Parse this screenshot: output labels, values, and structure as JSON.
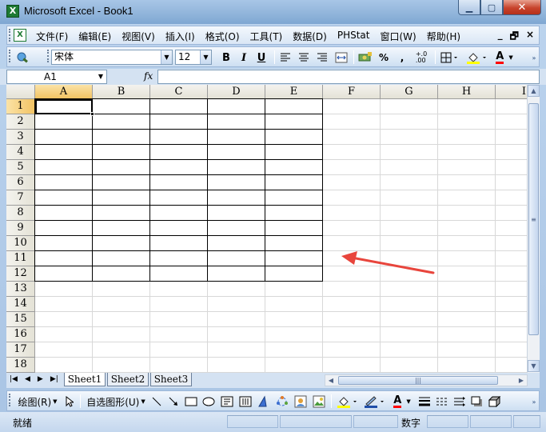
{
  "window": {
    "title": "Microsoft Excel - Book1",
    "app_icon": "excel-app-icon",
    "minimize": "minimize-icon",
    "maximize": "maximize-icon",
    "close": "close-icon"
  },
  "menu": {
    "items": [
      "文件(F)",
      "编辑(E)",
      "视图(V)",
      "插入(I)",
      "格式(O)",
      "工具(T)",
      "数据(D)",
      "PHStat",
      "窗口(W)",
      "帮助(H)"
    ],
    "doc_minimize": "_",
    "doc_restore": "🗗",
    "doc_close": "×"
  },
  "format_toolbar": {
    "font_name": "宋体",
    "font_size": "12",
    "bold": "B",
    "italic": "I",
    "underline": "U",
    "percent": "%",
    "comma": ",",
    "increase_decimal": "+.0\n.00",
    "font_color_letter": "A"
  },
  "namebar": {
    "name_box": "A1",
    "fx": "fx",
    "formula": ""
  },
  "grid": {
    "columns": [
      "A",
      "B",
      "C",
      "D",
      "E",
      "F",
      "G",
      "H",
      "I"
    ],
    "rows": [
      "1",
      "2",
      "3",
      "4",
      "5",
      "6",
      "7",
      "8",
      "9",
      "10",
      "11",
      "12",
      "13",
      "14",
      "15",
      "16",
      "17",
      "18"
    ],
    "active_cell": "A1",
    "bordered_range": "A1:E12",
    "annotation_color": "#e8453c"
  },
  "sheets": {
    "tabs": [
      "Sheet1",
      "Sheet2",
      "Sheet3"
    ],
    "active": "Sheet1"
  },
  "drawing_toolbar": {
    "draw_menu": "绘图(R)",
    "autoshapes": "自选图形(U)",
    "font_color_letter": "A"
  },
  "status": {
    "ready": "就绪",
    "num": "数字"
  }
}
